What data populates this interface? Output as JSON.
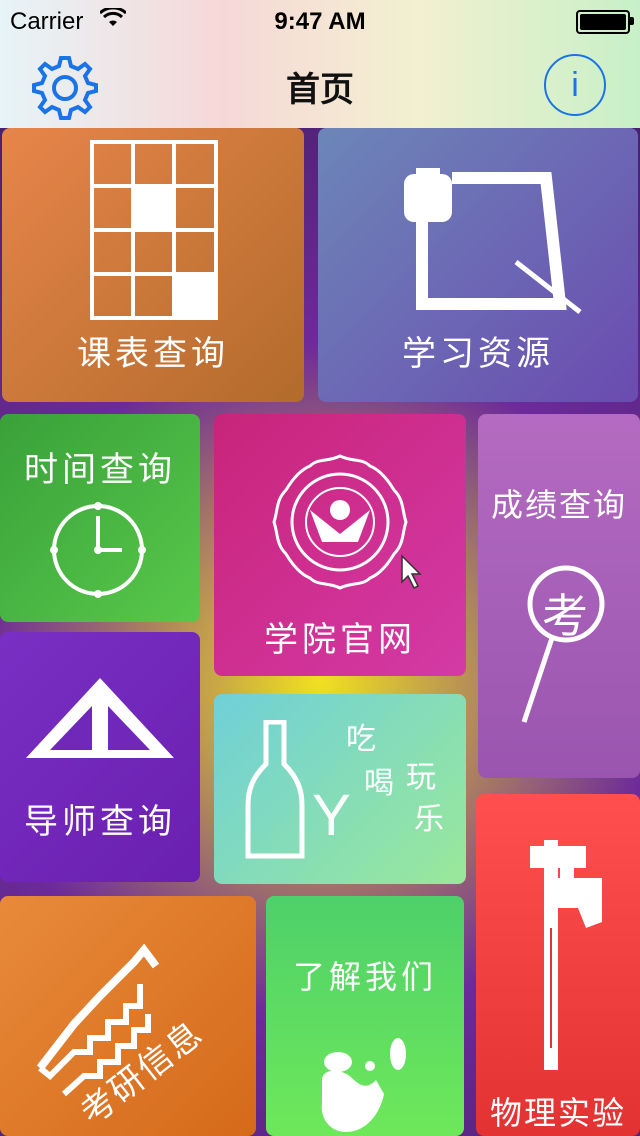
{
  "status": {
    "carrier": "Carrier",
    "time": "9:47 AM"
  },
  "nav": {
    "title": "首页",
    "info_label": "i"
  },
  "tiles": {
    "course": "课表查询",
    "resource": "学习资源",
    "time": "时间查询",
    "college": "学院官网",
    "grade": "成绩查询",
    "grade_icon_char": "考",
    "tutor": "导师查询",
    "fun_y": "Y",
    "fun_words": [
      "吃",
      "喝",
      "玩",
      "乐"
    ],
    "exam": "考研信息",
    "about": "了解我们",
    "physics": "物理实验"
  },
  "colors": {
    "accent": "#1a74e8"
  }
}
